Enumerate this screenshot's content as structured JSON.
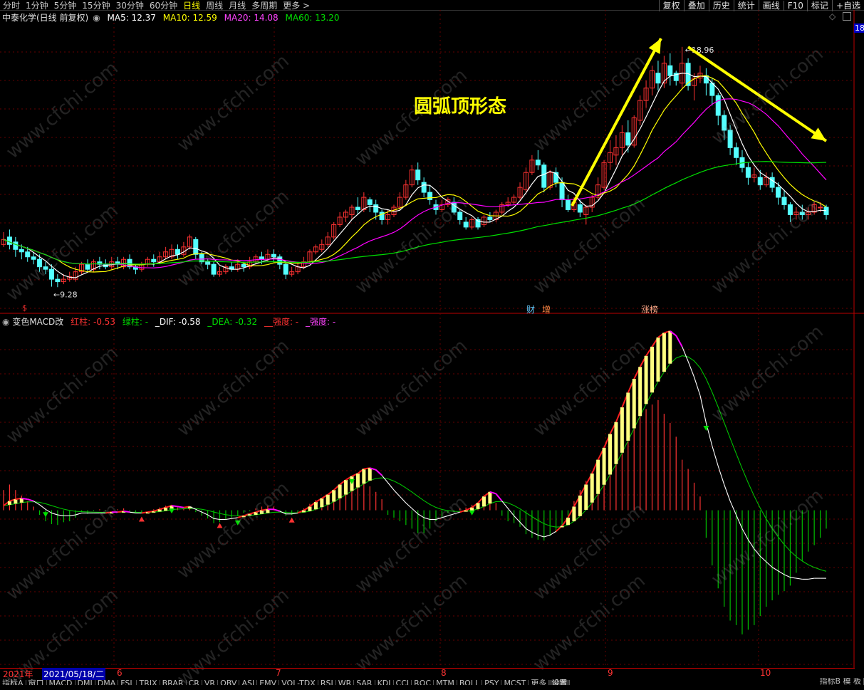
{
  "topbar": {
    "periods": [
      "分时",
      "1分钟",
      "5分钟",
      "15分钟",
      "30分钟",
      "60分钟",
      "日线",
      "周线",
      "月线",
      "多周期",
      "更多 >"
    ],
    "active_period": "日线",
    "tools": [
      "复权",
      "叠加",
      "历史",
      "统计",
      "画线",
      "F10",
      "标记",
      "+自选"
    ]
  },
  "legend": {
    "title": "中泰化学(日线 前复权)",
    "ma5": "MA5: 12.37",
    "ma10": "MA10: 12.59",
    "ma20": "MA20: 14.08",
    "ma60": "MA60: 13.20",
    "right_label": "18"
  },
  "macd_legend": {
    "title": "变色MACD改",
    "red": "红柱: -0.53",
    "green": "绿柱: -",
    "dif": "_DIF: -0.58",
    "dea": "_DEA: -0.32",
    "qd1": "__强度: -",
    "qd2": "_强度: -"
  },
  "annotation": "圆弧顶形态",
  "markers": {
    "cai": "财",
    "zeng": "增",
    "zhangbang": "涨榜",
    "s": "$"
  },
  "high_label": "18.96",
  "low_label": "9.28",
  "dates": {
    "year": "2021年",
    "selected": "2021/05/18/二",
    "m6": "6",
    "m7": "7",
    "m8": "8",
    "m9": "9",
    "m10": "10"
  },
  "tabs": [
    "指标A",
    "窗口",
    "MACD",
    "DMI",
    "DMA",
    "FSL",
    "TRIX",
    "BRAR",
    "CR",
    "VR",
    "OBV",
    "ASI",
    "EMV",
    "VOL-TDX",
    "RSI",
    "WR",
    "SAR",
    "KDJ",
    "CCI",
    "ROC",
    "MTM",
    "BOLL",
    "PSY",
    "MCST",
    "更多",
    "设置"
  ],
  "tabs_right": "指标B 模 板",
  "watermark": "www.cfchi.com",
  "colors": {
    "up": "#ff3232",
    "down": "#54ffff",
    "ma5": "#ffffff",
    "ma10": "#ffff00",
    "ma20": "#ff00ff",
    "ma60": "#00e000",
    "dif": "#ffffff",
    "dea": "#00c000",
    "red_bar": "#ff3232",
    "green_bar": "#00c000",
    "yellow_bar": "#ffff80",
    "arrow": "#ffff00"
  },
  "chart_data": [
    {
      "type": "candlestick",
      "title": "中泰化学(日线 前复权)",
      "ylim": [
        8.8,
        19.7
      ],
      "candles": [
        [
          11.0,
          11.2,
          10.9,
          11.5
        ],
        [
          11.3,
          11.0,
          10.8,
          11.6
        ],
        [
          11.1,
          10.8,
          10.5,
          11.3
        ],
        [
          10.8,
          10.7,
          10.4,
          11.0
        ],
        [
          10.7,
          10.5,
          10.3,
          10.9
        ],
        [
          10.5,
          10.4,
          10.2,
          10.7
        ],
        [
          10.4,
          10.1,
          9.9,
          10.6
        ],
        [
          10.1,
          10.0,
          9.8,
          10.3
        ],
        [
          10.0,
          9.6,
          9.3,
          10.2
        ],
        [
          9.6,
          9.5,
          9.28,
          9.8
        ],
        [
          9.5,
          9.6,
          9.4,
          9.8
        ],
        [
          9.6,
          9.7,
          9.5,
          9.9
        ],
        [
          9.6,
          9.9,
          9.5,
          10.1
        ],
        [
          9.9,
          10.2,
          9.8,
          10.3
        ],
        [
          10.2,
          10.0,
          9.9,
          10.4
        ],
        [
          10.0,
          10.3,
          9.9,
          10.4
        ],
        [
          10.3,
          10.2,
          10.0,
          10.5
        ],
        [
          10.2,
          10.1,
          10.0,
          10.4
        ],
        [
          10.1,
          10.3,
          10.0,
          10.5
        ],
        [
          10.3,
          10.2,
          10.0,
          10.5
        ],
        [
          10.1,
          10.4,
          10.0,
          10.5
        ],
        [
          10.4,
          10.1,
          10.0,
          10.6
        ],
        [
          10.1,
          10.0,
          9.8,
          10.2
        ],
        [
          10.0,
          10.2,
          9.9,
          10.3
        ],
        [
          10.2,
          10.4,
          10.1,
          10.5
        ],
        [
          10.4,
          10.3,
          10.1,
          10.6
        ],
        [
          10.3,
          10.5,
          10.2,
          10.7
        ],
        [
          10.5,
          10.7,
          10.4,
          10.9
        ],
        [
          10.5,
          10.8,
          10.4,
          11.0
        ],
        [
          10.8,
          10.6,
          10.4,
          11.0
        ],
        [
          10.6,
          10.9,
          10.5,
          11.1
        ],
        [
          10.9,
          11.3,
          10.8,
          11.4
        ],
        [
          11.2,
          10.6,
          10.4,
          11.3
        ],
        [
          10.6,
          10.3,
          10.2,
          10.7
        ],
        [
          10.3,
          10.2,
          10.0,
          10.4
        ],
        [
          10.2,
          9.8,
          9.7,
          10.3
        ],
        [
          9.8,
          9.9,
          9.7,
          10.1
        ],
        [
          9.9,
          10.1,
          9.8,
          10.2
        ],
        [
          10.1,
          10.0,
          9.9,
          10.3
        ],
        [
          10.0,
          10.2,
          9.9,
          10.4
        ],
        [
          10.2,
          10.1,
          9.9,
          10.3
        ],
        [
          10.1,
          10.3,
          10.0,
          10.5
        ],
        [
          10.3,
          10.5,
          10.2,
          10.6
        ],
        [
          10.5,
          10.4,
          10.2,
          10.7
        ],
        [
          10.4,
          10.6,
          10.3,
          10.8
        ],
        [
          10.6,
          10.5,
          10.3,
          10.8
        ],
        [
          10.5,
          10.2,
          10.0,
          10.6
        ],
        [
          10.2,
          9.8,
          9.6,
          10.3
        ],
        [
          9.8,
          9.9,
          9.7,
          10.1
        ],
        [
          9.9,
          10.1,
          9.8,
          10.3
        ],
        [
          10.1,
          10.3,
          10.0,
          10.5
        ],
        [
          10.3,
          10.7,
          10.2,
          10.8
        ],
        [
          10.7,
          10.9,
          10.6,
          11.0
        ],
        [
          10.8,
          11.0,
          10.7,
          11.2
        ],
        [
          11.0,
          11.3,
          10.9,
          11.5
        ],
        [
          11.3,
          11.8,
          11.2,
          11.9
        ],
        [
          11.8,
          12.1,
          11.7,
          12.3
        ],
        [
          12.1,
          12.3,
          11.9,
          12.4
        ],
        [
          12.2,
          12.5,
          12.0,
          12.6
        ],
        [
          12.5,
          12.4,
          12.2,
          12.9
        ],
        [
          12.4,
          12.9,
          12.3,
          13.1
        ],
        [
          12.8,
          12.6,
          12.3,
          12.9
        ],
        [
          12.6,
          12.3,
          12.0,
          12.8
        ],
        [
          12.3,
          12.0,
          11.8,
          12.4
        ],
        [
          12.0,
          12.2,
          11.8,
          12.4
        ],
        [
          12.2,
          12.5,
          12.1,
          12.6
        ],
        [
          12.5,
          12.9,
          12.4,
          13.1
        ],
        [
          12.9,
          13.4,
          12.8,
          13.6
        ],
        [
          13.4,
          14.0,
          13.3,
          14.2
        ],
        [
          14.0,
          13.6,
          13.4,
          14.3
        ],
        [
          13.5,
          13.1,
          12.9,
          13.7
        ],
        [
          13.1,
          12.8,
          12.6,
          13.4
        ],
        [
          12.6,
          12.4,
          12.2,
          12.8
        ],
        [
          12.4,
          12.6,
          12.3,
          12.8
        ],
        [
          12.6,
          12.8,
          12.5,
          12.9
        ],
        [
          12.7,
          12.3,
          12.2,
          12.9
        ],
        [
          12.3,
          12.0,
          11.8,
          12.4
        ],
        [
          11.9,
          11.7,
          11.6,
          12.1
        ],
        [
          11.7,
          12.0,
          11.6,
          12.1
        ],
        [
          12.0,
          11.7,
          11.6,
          12.1
        ],
        [
          11.8,
          12.1,
          11.7,
          12.2
        ],
        [
          12.1,
          12.0,
          11.9,
          12.3
        ],
        [
          12.0,
          12.3,
          11.9,
          12.4
        ],
        [
          12.3,
          12.6,
          12.2,
          12.7
        ],
        [
          12.6,
          12.7,
          12.5,
          12.9
        ],
        [
          12.7,
          12.9,
          12.6,
          13.0
        ],
        [
          12.9,
          13.3,
          12.8,
          13.5
        ],
        [
          13.2,
          13.9,
          13.1,
          14.1
        ],
        [
          13.9,
          14.4,
          13.8,
          14.6
        ],
        [
          14.4,
          14.2,
          14.0,
          14.8
        ],
        [
          14.2,
          13.3,
          13.1,
          14.3
        ],
        [
          13.3,
          13.9,
          13.2,
          14.0
        ],
        [
          13.9,
          13.5,
          13.3,
          14.1
        ],
        [
          13.5,
          12.8,
          12.5,
          13.7
        ],
        [
          12.8,
          12.4,
          12.3,
          13.0
        ],
        [
          12.4,
          12.7,
          12.3,
          12.9
        ],
        [
          12.6,
          12.3,
          12.1,
          12.8
        ],
        [
          12.2,
          12.5,
          11.8,
          12.6
        ],
        [
          12.5,
          12.9,
          12.3,
          13.0
        ],
        [
          12.9,
          13.4,
          12.8,
          13.7
        ],
        [
          13.3,
          14.3,
          13.2,
          14.4
        ],
        [
          14.3,
          14.7,
          14.0,
          15.2
        ],
        [
          14.6,
          14.9,
          14.2,
          15.4
        ],
        [
          14.9,
          15.5,
          14.6,
          15.8
        ],
        [
          15.5,
          15.0,
          14.7,
          16.0
        ],
        [
          15.0,
          16.1,
          14.9,
          16.2
        ],
        [
          16.0,
          16.8,
          15.8,
          17.0
        ],
        [
          16.8,
          17.3,
          16.5,
          17.6
        ],
        [
          17.3,
          18.0,
          17.0,
          18.2
        ],
        [
          17.9,
          17.5,
          17.2,
          18.4
        ],
        [
          17.5,
          18.3,
          17.3,
          18.6
        ],
        [
          18.2,
          17.8,
          17.4,
          18.7
        ],
        [
          17.9,
          17.6,
          17.4,
          18.0
        ],
        [
          17.5,
          18.3,
          17.3,
          18.96
        ],
        [
          18.3,
          17.4,
          17.2,
          18.5
        ],
        [
          17.4,
          17.7,
          16.8,
          17.9
        ],
        [
          17.7,
          17.9,
          17.5,
          18.2
        ],
        [
          17.8,
          17.5,
          17.0,
          18.1
        ],
        [
          17.5,
          17.0,
          16.6,
          17.7
        ],
        [
          17.0,
          16.2,
          15.8,
          17.1
        ],
        [
          16.2,
          15.6,
          15.2,
          16.4
        ],
        [
          15.6,
          14.9,
          14.6,
          15.8
        ],
        [
          14.9,
          14.5,
          14.2,
          15.1
        ],
        [
          14.5,
          14.1,
          13.9,
          14.8
        ],
        [
          14.1,
          13.7,
          13.4,
          14.3
        ],
        [
          13.7,
          13.8,
          13.5,
          14.1
        ],
        [
          13.7,
          13.4,
          13.2,
          14.0
        ],
        [
          13.4,
          13.7,
          13.3,
          13.9
        ],
        [
          13.7,
          13.3,
          13.1,
          13.9
        ],
        [
          13.3,
          12.9,
          12.6,
          13.5
        ],
        [
          12.9,
          12.6,
          12.4,
          13.2
        ],
        [
          12.6,
          12.2,
          11.9,
          12.7
        ],
        [
          12.2,
          12.3,
          12.0,
          12.5
        ],
        [
          12.3,
          12.2,
          12.0,
          12.6
        ],
        [
          12.2,
          12.3,
          12.0,
          12.5
        ],
        [
          12.3,
          12.6,
          12.2,
          12.7
        ],
        [
          12.5,
          12.5,
          12.3,
          12.7
        ],
        [
          12.5,
          12.2,
          12.0,
          12.6
        ]
      ]
    },
    {
      "type": "bar",
      "title": "变色MACD改",
      "ylim": [
        -1.7,
        2.05
      ],
      "macd": [
        0.22,
        0.28,
        0.22,
        0.16,
        0.1,
        0.04,
        -0.05,
        -0.12,
        -0.15,
        -0.16,
        -0.13,
        -0.12,
        -0.08,
        -0.02,
        -0.04,
        -0.01,
        0.01,
        -0.01,
        0.0,
        0.01,
        0.02,
        -0.01,
        -0.03,
        -0.02,
        0.0,
        0.01,
        0.03,
        0.05,
        0.06,
        0.03,
        0.02,
        0.04,
        -0.02,
        -0.06,
        -0.09,
        -0.14,
        -0.13,
        -0.1,
        -0.08,
        -0.06,
        -0.03,
        -0.01,
        0.02,
        0.04,
        0.05,
        0.04,
        -0.01,
        -0.06,
        -0.05,
        -0.03,
        0.02,
        0.07,
        0.11,
        0.13,
        0.16,
        0.2,
        0.26,
        0.28,
        0.31,
        0.28,
        0.33,
        0.26,
        0.2,
        0.12,
        -0.05,
        -0.08,
        -0.12,
        -0.16,
        -0.2,
        -0.25,
        -0.25,
        -0.2,
        -0.12,
        -0.08,
        -0.03,
        -0.02,
        0.02,
        0.03,
        0.06,
        0.08,
        0.14,
        0.12,
        0.08,
        -0.06,
        -0.12,
        -0.14,
        -0.18,
        -0.26,
        -0.3,
        -0.32,
        -0.33,
        -0.28,
        -0.24,
        -0.18,
        -0.06,
        0.1,
        0.22,
        0.32,
        0.42,
        0.55,
        0.6,
        0.7,
        0.68,
        0.82,
        0.92,
        1.0,
        1.05,
        1.1,
        1.15,
        1.2,
        1.05,
        0.95,
        0.8,
        0.55,
        0.45,
        0.3,
        0.15,
        -0.3,
        -0.6,
        -0.85,
        -1.05,
        -1.2,
        -1.25,
        -1.35,
        -1.3,
        -1.25,
        -1.15,
        -1.05,
        -0.98,
        -0.92,
        -0.88,
        -0.82,
        -0.68,
        -0.55,
        -0.45,
        -0.38,
        -0.3,
        -0.2
      ],
      "dif": [
        0.05,
        0.1,
        0.12,
        0.13,
        0.12,
        0.1,
        0.06,
        0.01,
        -0.03,
        -0.05,
        -0.06,
        -0.06,
        -0.05,
        -0.03,
        -0.03,
        -0.03,
        -0.03,
        -0.03,
        -0.02,
        -0.02,
        -0.01,
        -0.02,
        -0.03,
        -0.03,
        -0.02,
        -0.01,
        0.01,
        0.03,
        0.05,
        0.04,
        0.03,
        0.04,
        0.01,
        -0.02,
        -0.05,
        -0.09,
        -0.1,
        -0.1,
        -0.09,
        -0.08,
        -0.06,
        -0.04,
        -0.02,
        0.0,
        0.01,
        0.01,
        -0.01,
        -0.04,
        -0.04,
        -0.03,
        0.0,
        0.04,
        0.09,
        0.13,
        0.17,
        0.22,
        0.28,
        0.33,
        0.37,
        0.4,
        0.45,
        0.46,
        0.44,
        0.38,
        0.3,
        0.22,
        0.15,
        0.08,
        0.02,
        -0.04,
        -0.08,
        -0.1,
        -0.1,
        -0.08,
        -0.06,
        -0.04,
        -0.02,
        0.0,
        0.03,
        0.08,
        0.15,
        0.2,
        0.18,
        0.1,
        0.02,
        -0.06,
        -0.13,
        -0.2,
        -0.24,
        -0.27,
        -0.29,
        -0.27,
        -0.23,
        -0.17,
        -0.08,
        0.04,
        0.16,
        0.28,
        0.4,
        0.55,
        0.68,
        0.83,
        0.96,
        1.12,
        1.28,
        1.43,
        1.56,
        1.68,
        1.78,
        1.88,
        1.93,
        1.95,
        1.9,
        1.78,
        1.62,
        1.45,
        1.25,
        0.95,
        0.7,
        0.48,
        0.28,
        0.1,
        -0.05,
        -0.2,
        -0.32,
        -0.42,
        -0.5,
        -0.56,
        -0.62,
        -0.66,
        -0.7,
        -0.73,
        -0.74,
        -0.75,
        -0.75,
        -0.74,
        -0.74,
        -0.74
      ]
    }
  ]
}
